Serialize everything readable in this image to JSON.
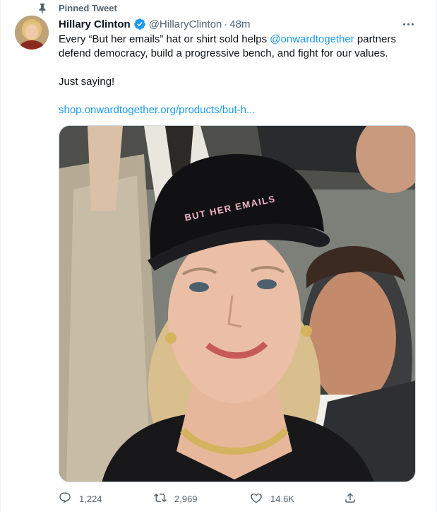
{
  "pinned": {
    "label": "Pinned Tweet"
  },
  "author": {
    "name": "Hillary Clinton",
    "handle": "@HillaryClinton",
    "separator": "·",
    "time": "48m"
  },
  "tweet": {
    "line1_before": "Every “But her emails” hat or shirt sold helps ",
    "mention": "@onwardtogether",
    "line1_after": " partners",
    "line2": "defend democracy, build a progressive bench, and fight for our values.",
    "line3": "Just saying!",
    "link": "shop.onwardtogether.org/products/but-h..."
  },
  "media": {
    "hat_text": "BUT HER EMAILS"
  },
  "actions": {
    "replies": "1,224",
    "retweets": "2,969",
    "likes": "14.6K"
  },
  "icons": {
    "pin": "pin-icon",
    "verified": "verified-badge-icon",
    "more": "more-options-icon",
    "reply": "reply-icon",
    "retweet": "retweet-icon",
    "like": "heart-icon",
    "share": "share-icon"
  },
  "colors": {
    "accent": "#1d9bf0",
    "secondary_text": "#536471",
    "primary_text": "#0f1419"
  }
}
